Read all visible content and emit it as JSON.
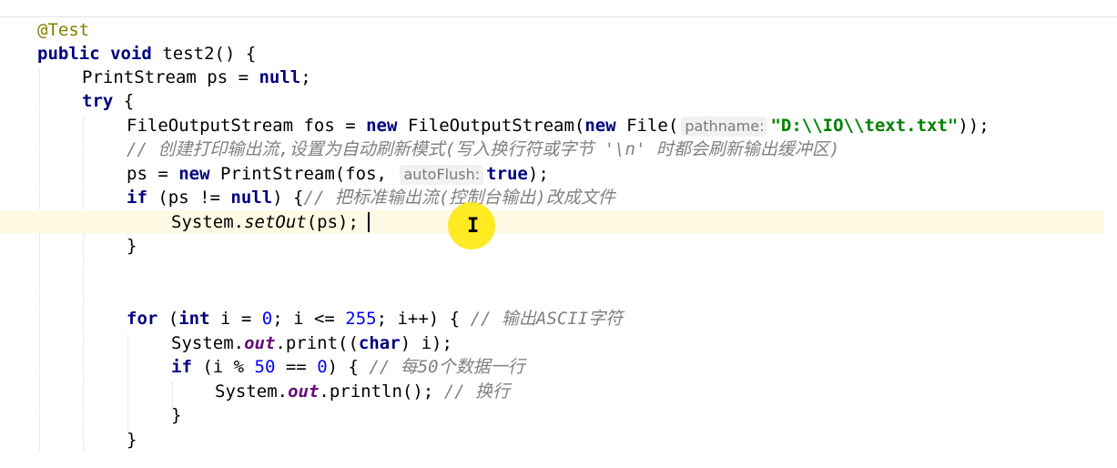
{
  "editor": {
    "lines": [
      {
        "id": "annotation",
        "text": "@Test"
      },
      {
        "id": "method-signature",
        "kw1": "public",
        "kw2": "void",
        "name": "test2() {"
      },
      {
        "id": "ps-decl",
        "type": "PrintStream ps = ",
        "kw": "null",
        "end": ";"
      },
      {
        "id": "try",
        "kw": "try",
        "rest": " {"
      },
      {
        "id": "fos-decl",
        "a": "FileOutputStream fos = ",
        "kw1": "new",
        "b": " FileOutputStream(",
        "kw2": "new",
        "c": " File(",
        "hint": "pathname:",
        "str": "\"D:\\\\IO\\\\text.txt\"",
        "end": "));"
      },
      {
        "id": "comment-create",
        "text": "// 创建打印输出流,设置为自动刷新模式(写入换行符或字节 '\\n' 时都会刷新输出缓冲区)"
      },
      {
        "id": "ps-assign",
        "a": "ps = ",
        "kw": "new",
        "b": " PrintStream(fos, ",
        "hint": "autoFlush:",
        "kw2": "true",
        "end": ");"
      },
      {
        "id": "if-ps",
        "kw": "if",
        "a": " (ps != ",
        "kw2": "null",
        "b": ") {",
        "comment": "// 把标准输出流(控制台输出)改成文件"
      },
      {
        "id": "setout",
        "a": "System.",
        "method": "setOut",
        "b": "(ps);"
      },
      {
        "id": "close-if",
        "text": "}"
      },
      {
        "id": "for",
        "kw": "for",
        "a": " (",
        "kw2": "int",
        "b": " i = ",
        "n1": "0",
        "c": "; i <= ",
        "n2": "255",
        "d": "; i++) { ",
        "comment": "// 输出ASCII字符"
      },
      {
        "id": "print-char",
        "a": "System.",
        "field": "out",
        "b": ".print((",
        "kw": "char",
        "c": ") i);"
      },
      {
        "id": "if-mod",
        "kw": "if",
        "a": " (i % ",
        "n1": "50",
        "b": " == ",
        "n2": "0",
        "c": ") { ",
        "comment": "// 每50个数据一行"
      },
      {
        "id": "println",
        "a": "System.",
        "field": "out",
        "b": ".println(); ",
        "comment": "// 换行"
      },
      {
        "id": "close-if-mod",
        "text": "}"
      },
      {
        "id": "close-for",
        "text": "}"
      }
    ],
    "colors": {
      "keyword": "#000080",
      "string": "#008000",
      "comment": "#808080",
      "number": "#0000ff",
      "field": "#660e7a",
      "annotation": "#808000",
      "current_line": "#fffae3",
      "mouse_highlight": "#ffe600"
    }
  }
}
